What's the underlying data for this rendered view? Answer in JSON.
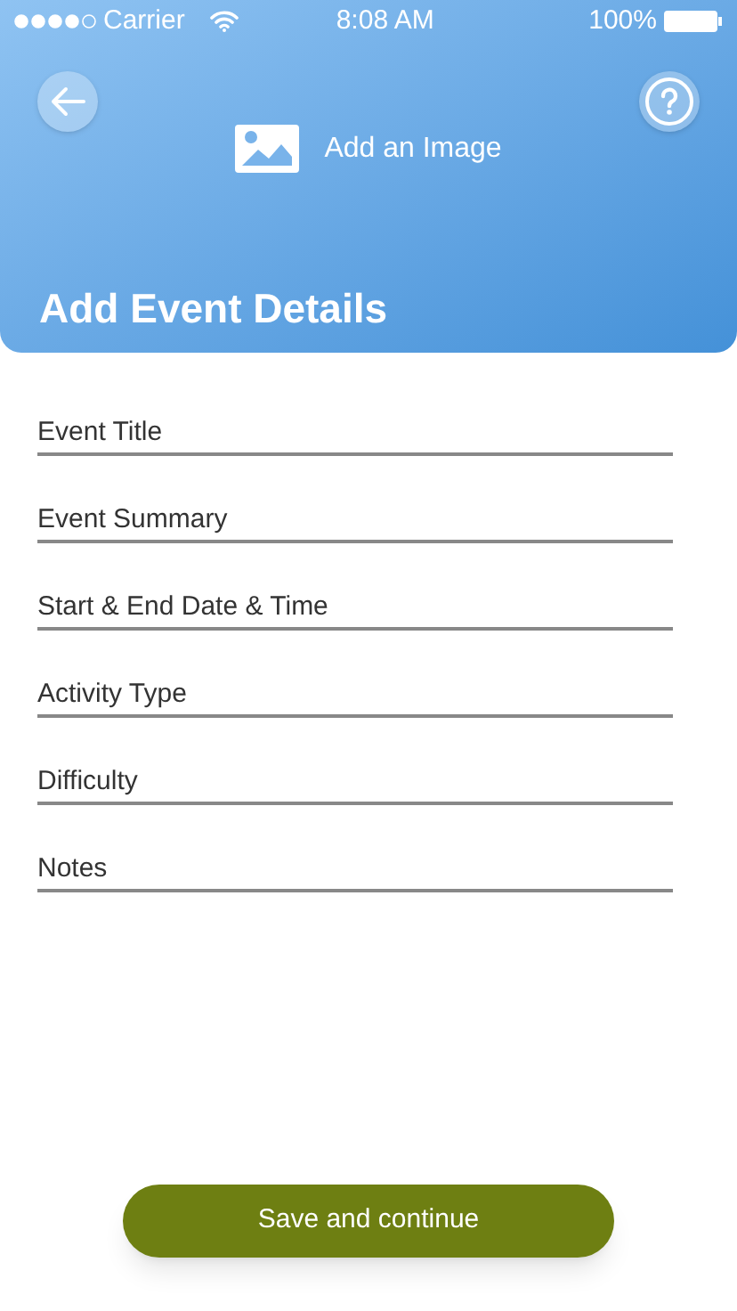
{
  "status_bar": {
    "carrier": "Carrier",
    "time": "8:08 AM",
    "battery": "100%"
  },
  "header": {
    "image_button": "Add an Image",
    "title": "Add Event Details"
  },
  "fields": [
    {
      "placeholder": "Event Title"
    },
    {
      "placeholder": "Event Summary"
    },
    {
      "placeholder": "Start & End Date & Time"
    },
    {
      "placeholder": "Activity Type"
    },
    {
      "placeholder": "Difficulty"
    },
    {
      "placeholder": "Notes"
    }
  ],
  "save_button": "Save and continue"
}
